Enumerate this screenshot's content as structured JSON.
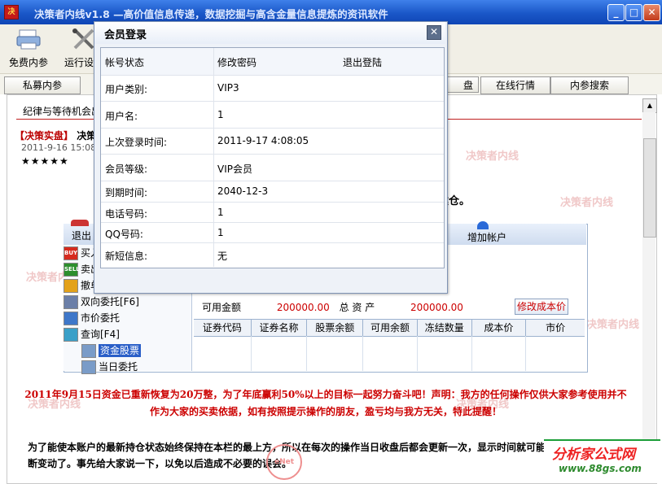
{
  "window": {
    "title": "决策者内线v1.8 —高价值信息传递，数据挖掘与高含金量信息提炼的资讯软件",
    "icon_text": "决"
  },
  "toolbar": {
    "items": [
      {
        "label": "免费内参",
        "icon": "printer-icon"
      },
      {
        "label": "运行设置",
        "icon": "tools-icon"
      }
    ]
  },
  "tabs": [
    "私募内参",
    "盘",
    "在线行情",
    "内参搜索"
  ],
  "content": {
    "subtitle": "纪律与等待机会出",
    "post_header_tag": "【决策实盘】",
    "post_header_text": "决策",
    "post_date": "2011-9-16  15:08",
    "stars": "★★★★★",
    "post_tail": "建仓。",
    "watermark": "决策者内线"
  },
  "trade": {
    "exit": "退出",
    "add_account": "增加帐户",
    "tree": [
      {
        "label": "买入",
        "icon_text": "BUY",
        "color": "#d62a1e"
      },
      {
        "label": "卖出",
        "icon_text": "SELL",
        "color": "#2d8f2d"
      },
      {
        "label": "撤单",
        "icon_text": "",
        "color": "#e3a21a"
      },
      {
        "label": "双向委托[F6]",
        "icon_text": "",
        "color": "#6b7fa8"
      },
      {
        "label": "市价委托",
        "icon_text": "",
        "color": "#3e77c9"
      },
      {
        "label": "查询[F4]",
        "icon_text": "",
        "color": "#3aa0c8"
      },
      {
        "label": "资金股票",
        "icon_text": "",
        "color": "#7a9cc8",
        "selected": true
      },
      {
        "label": "当日委托",
        "icon_text": "",
        "color": "#7a9cc8"
      }
    ],
    "red_a": "0",
    "red_b": "0",
    "available_label": "可用金额",
    "available_value": "200000.00",
    "total_label": "总 资 产",
    "total_value": "200000.00",
    "modify_cost": "修改成本价",
    "columns": [
      "证券代码",
      "证券名称",
      "股票余额",
      "可用余额",
      "冻结数量",
      "成本价",
      "市价"
    ]
  },
  "notice": "2011年9月15日资金已重新恢复为20万整，为了年底赢利50%以上的目标一起努力奋斗吧！声明：我方的任何操作仅供大家参考使用并不作为大家的买卖依据，如有按照提示操作的朋友，盈亏均与我方无关，特此提醒！",
  "para": "为了能使本账户的最新持仓状态始终保持在本栏的最上方，所以在每次的操作当日收盘后都会更新一次，显示时间就可能要随更新的时间不间断变动了。事先给大家说一下，以免以后造成不必要的误会。",
  "logo": {
    "main": "分析家公式网",
    "url": "www.88gs.com"
  },
  "stamp_text": "eNet",
  "dialog": {
    "title": "会员登录",
    "header": {
      "k": "帐号状态",
      "v1": "修改密码",
      "v2": "退出登陆"
    },
    "rows": [
      {
        "k": "用户类别:",
        "v": "VIP3"
      },
      {
        "k": "用户名:",
        "v": "1"
      },
      {
        "k": "上次登录时间:",
        "v": "2011-9-17 4:08:05"
      },
      {
        "k": "会员等级:",
        "v": "VIP会员"
      },
      {
        "k": "到期时间:",
        "v": "2040-12-3"
      },
      {
        "k": "电话号码:",
        "v": "1"
      },
      {
        "k": "QQ号码:",
        "v": "1"
      },
      {
        "k": "新短信息:",
        "v": "无"
      }
    ]
  }
}
